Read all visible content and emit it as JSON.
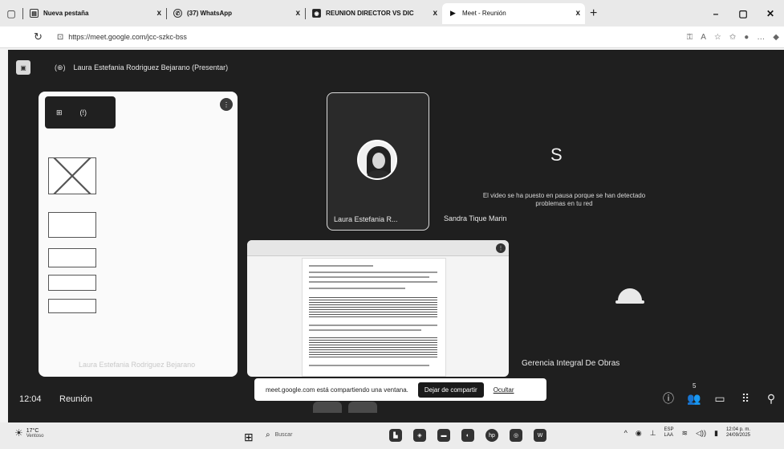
{
  "browser": {
    "tabs": [
      {
        "label": "Nueva pestaña",
        "icon": "page-icon",
        "active": false
      },
      {
        "label": "(37) WhatsApp",
        "icon": "whatsapp-icon",
        "active": false
      },
      {
        "label": "REUNION DIRECTOR VS DIC",
        "icon": "record-icon",
        "active": false
      },
      {
        "label": "Meet - Reunión",
        "icon": "meet-icon",
        "active": true
      }
    ],
    "new_tab": "+",
    "close_glyph": "x",
    "url": "https://meet.google.com/jcc-szkc-bss",
    "window_controls": [
      "–",
      "▢",
      "✕"
    ]
  },
  "meet": {
    "presenter_title": "Laura Estefania Rodriguez Bejarano (Presentar)",
    "share_tile_name": "Laura Estefania Rodriguez Bejarano",
    "participants": [
      {
        "name": "Laura Estefania R...",
        "initial": ""
      },
      {
        "name": "Sandra Tique Marin",
        "initial": "S",
        "message": "El video se ha puesto en pausa porque se han detectado problemas en tu red"
      },
      {
        "name": "Gerencia Integral De Obras",
        "initial": ""
      }
    ],
    "share_notice": {
      "message": "meet.google.com está compartiendo una ventana.",
      "stop_label": "Dejar de compartir",
      "hide_label": "Ocultar"
    },
    "footer": {
      "time": "12:04",
      "title": "Reunión"
    },
    "participant_count": "5"
  },
  "taskbar": {
    "temperature": "17°C",
    "condition": "Ventoso",
    "search_placeholder": "Buscar",
    "lang_top": "ESP",
    "lang_bottom": "LAA",
    "time": "12:04 p. m.",
    "date": "24/09/2025"
  }
}
